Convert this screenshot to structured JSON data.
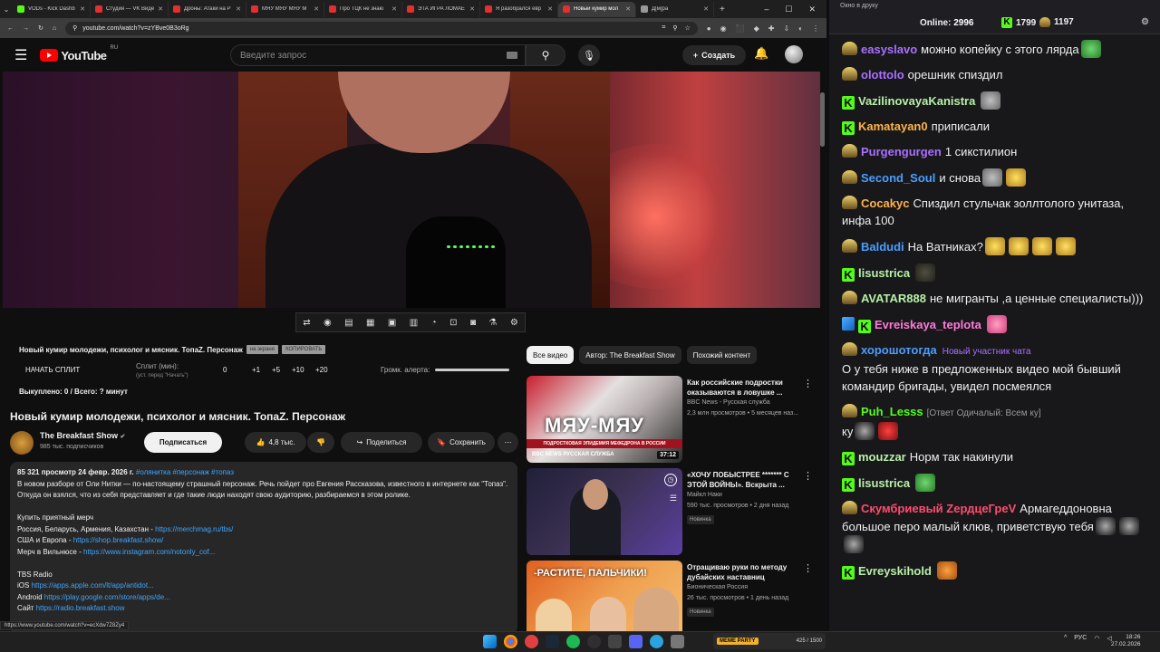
{
  "browser": {
    "tabs": [
      {
        "title": "VODs - Kick Dashb",
        "color": "#53fc18"
      },
      {
        "title": "Студия — VK Видео",
        "color": "#e03030"
      },
      {
        "title": "Дроны: Атаки на Р",
        "color": "#e03030"
      },
      {
        "title": "МЯУ МЯУ МЯУ М",
        "color": "#e03030"
      },
      {
        "title": "Про ТЦК не знаю",
        "color": "#e03030"
      },
      {
        "title": "ЭТА ИГРА ЛОМАЕ",
        "color": "#e03030"
      },
      {
        "title": "Я разобрался евр",
        "color": "#e03030"
      },
      {
        "title": "Новый кумир мол",
        "color": "#e03030",
        "active": true
      },
      {
        "title": "Д[м]ра",
        "color": "#999999"
      }
    ],
    "url": "youtube.com/watch?v=zYBve0B3oRg"
  },
  "youtube": {
    "logo_text": "YouTube",
    "logo_region": "RU",
    "search_placeholder": "Введите запрос",
    "create_label": "Создать",
    "split": {
      "title": "Новый кумир молодежи, психолог и мясник. ТопаZ. Персонаж",
      "btn_full": "на экране",
      "btn_copy": "КОПИРОВАТЬ",
      "start_label": "НАЧАТЬ СПЛИТ",
      "split_min_label": "Сплит (мин):",
      "split_min_sub": "(уст. перед \"Начать\")",
      "values": [
        "0",
        "+1",
        "+5",
        "+10",
        "+20"
      ],
      "alert_label": "Громк. алерта:",
      "bought": "Выкуплено: 0 / Всего: ? минут"
    },
    "video_title": "Новый кумир молодежи, психолог и мясник. ТопаZ. Персонаж",
    "channel": {
      "name": "The Breakfast Show",
      "verified": "✔",
      "subs": "985 тыс. подписчиков",
      "subscribe_label": "Подписаться",
      "likes": "4,8 тыс.",
      "share_label": "Поделиться",
      "save_label": "Сохранить"
    },
    "description": {
      "meta": "85 321 просмотр  24 февр. 2026 г.",
      "tags": "#олянитка #персонаж #топаз",
      "lines": [
        {
          "text": "В новом разборе от Оли Нитки — по-настоящему страшный персонаж. Речь пойдет про Евгения Рассказова, известного в интернете как \"Топаз\". Откуда он взялся, что из себя представляет и где такие люди находят свою аудиторию, разбираемся в этом ролике.",
          "link": ""
        },
        {
          "text": "",
          "link": ""
        },
        {
          "text": "Купить приятный мерч",
          "link": ""
        },
        {
          "text": "Россия, Беларусь, Армения, Казахстан - ",
          "link": "https://merchmag.ru/tbs/"
        },
        {
          "text": "США и Европа - ",
          "link": "https://shop.breakfast.show/"
        },
        {
          "text": "Мерч в Вильнюсе - ",
          "link": "https://www.instagram.com/notonly_cof..."
        },
        {
          "text": "",
          "link": ""
        },
        {
          "text": "TBS Radio",
          "link": ""
        },
        {
          "text": "iOS ",
          "link": "https://apps.apple.com/lt/app/antidot..."
        },
        {
          "text": "Android ",
          "link": "https://play.google.com/store/apps/de..."
        },
        {
          "text": "Сайт ",
          "link": "https://radio.breakfast.show"
        }
      ]
    },
    "chips": [
      "Все видео",
      "Автор: The Breakfast Show",
      "Похожий контент"
    ],
    "recommendations": [
      {
        "title": "Как российские подростки оказываются в ловушке ...",
        "channel": "BBC News - Русская служба",
        "views": "2,3 млн просмотров • 5 месяцев наз...",
        "duration": "37:12",
        "badge": "",
        "thumb_text": "МЯУ-МЯУ",
        "thumb_strip": "ПОДРОСТКОВАЯ ЭПИДЕМИЯ МЕФЕДРОНА В РОССИИ",
        "thumb_brand": "BBC NEWS РУССКАЯ СЛУЖБА"
      },
      {
        "title": "«ХОЧУ ПОБЫСТРЕЕ ******* С ЭТОЙ ВОЙНЫ». Вскрыта ...",
        "channel": "Майкл Наки",
        "views": "590 тыс. просмотров • 2 дня назад",
        "duration": "",
        "badge": "Новинка",
        "thumb_text": "",
        "thumb_strip": "",
        "thumb_brand": ""
      },
      {
        "title": "Отращиваю руки по методу дубайских наставниц",
        "channel": "Бионическая Россия",
        "views": "26 тыс. просмотров • 1 день назад",
        "duration": "",
        "badge": "Новинка",
        "thumb_text": "-РАСТИТЕ, ПАЛЬЧИКИ!",
        "thumb_strip": "",
        "thumb_brand": ""
      }
    ],
    "status_url": "https://www.youtube.com/watch?v=ecXdw7Z8Zy4"
  },
  "chat": {
    "window_title": "Окно в друку",
    "online_label": "Online:",
    "online_count": "2996",
    "kick_count": "1799",
    "other_count": "1197",
    "messages": [
      {
        "badge": "hat",
        "name": "easyslavo",
        "color": "#a970ff",
        "text": "можно копейку с этого лярда",
        "emotes": [
          "green"
        ]
      },
      {
        "badge": "hat",
        "name": "olottolo",
        "color": "#a970ff",
        "text": "орешник спиздил",
        "emotes": []
      },
      {
        "badge": "k",
        "name": "VazilinovayaKanistra",
        "color": "#b8f0a8",
        "text": "",
        "emotes": [
          "gray"
        ]
      },
      {
        "badge": "k",
        "name": "Kamatayan0",
        "color": "#ffb347",
        "text": "приписали",
        "emotes": []
      },
      {
        "badge": "hat",
        "name": "Purgengurgen",
        "color": "#a970ff",
        "text": "1 сикстилион",
        "emotes": []
      },
      {
        "badge": "hat",
        "name": "Second_Soul",
        "color": "#4a9eff",
        "text": "и снова",
        "emotes": [
          "gray",
          "yellow"
        ]
      },
      {
        "badge": "hat",
        "name": "Cocakyc",
        "color": "#ffb347",
        "text": "Спиздил стульчак золлтолого унитаза, инфа 100",
        "emotes": []
      },
      {
        "badge": "hat",
        "name": "Baldudi",
        "color": "#4a9eff",
        "text": "На Ватниках?",
        "emotes": [
          "yellow",
          "yellow",
          "yellow",
          "yellow"
        ]
      },
      {
        "badge": "k",
        "name": "lisustrica",
        "color": "#b8f0a8",
        "text": "",
        "emotes": [
          "dark"
        ]
      },
      {
        "badge": "hat",
        "name": "AVATAR888",
        "color": "#b8f0a8",
        "text": "не мигранты ,а ценные специалисты)))",
        "emotes": []
      },
      {
        "badge": "swk",
        "name": "Evreiskaya_teplota",
        "color": "#ff7ad9",
        "text": "",
        "emotes": [
          "pink"
        ]
      },
      {
        "badge": "hat",
        "name": "хорошотогда",
        "color": "#4a9eff",
        "text": "О у тебя ниже в предложенных видео мой бывший командир бригады, увидел посмеялся",
        "emotes": [],
        "new_label": "Новый участник чата"
      },
      {
        "badge": "hat",
        "name": "Puh_Lesss",
        "color": "#53fc18",
        "text": "ку",
        "emotes": [
          "bw",
          "red"
        ],
        "reply": "[Ответ Одичалый: Всем ку]"
      },
      {
        "badge": "k",
        "name": "mouzzar",
        "color": "#b8f0a8",
        "text": "Норм так накинули",
        "emotes": []
      },
      {
        "badge": "k",
        "name": "lisustrica",
        "color": "#b8f0a8",
        "text": "",
        "emotes": [
          "green"
        ]
      },
      {
        "badge": "hat",
        "name": "Скумбриевый ZердцеГреV",
        "color": "#ff4d6d",
        "text": "Армагеддоновна большое перо малый клюв, приветствую тебя",
        "emotes": [
          "bw",
          "bw",
          "bw"
        ]
      },
      {
        "badge": "k",
        "name": "Evreyskihold",
        "color": "#b8f0a8",
        "text": "",
        "emotes": [
          "orange"
        ]
      }
    ]
  },
  "taskbar": {
    "meme_tag": "MEME PARTY",
    "meme_values": "425 / 1500",
    "lang": "РУС",
    "time": "18:26",
    "date": "27.02.2026"
  }
}
